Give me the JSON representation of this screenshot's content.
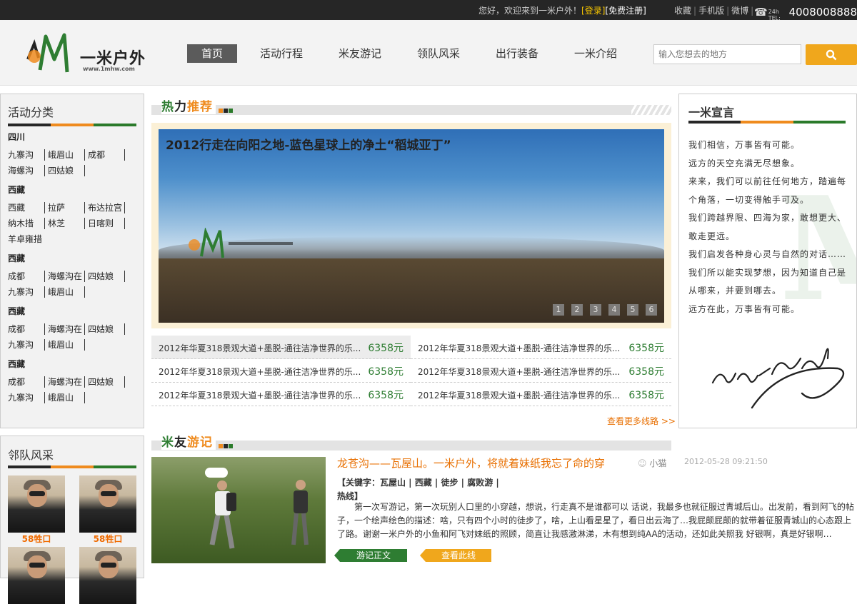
{
  "topbar": {
    "welcome": "您好，欢迎来到一米户外！",
    "login": "[登录]",
    "register": "[免费注册]",
    "links": [
      "收藏",
      "手机版",
      "微博"
    ],
    "tel_label": "24h TEL:",
    "tel_number": "4008008888"
  },
  "header": {
    "logo_text": "一米户外",
    "logo_url": "www.1mhw.com",
    "nav": [
      "首页",
      "活动行程",
      "米友游记",
      "领队风采",
      "出行装备",
      "一米介绍"
    ],
    "search_placeholder": "输入您想去的地方"
  },
  "categories": {
    "title": "活动分类",
    "groups": [
      {
        "region": "四川",
        "rows": [
          [
            "九寨沟",
            "峨眉山",
            "成都"
          ],
          [
            "海螺沟",
            "四姑娘"
          ]
        ]
      },
      {
        "region": "西藏",
        "rows": [
          [
            "西藏",
            "拉萨",
            "布达拉宫"
          ],
          [
            "纳木措",
            "林芝",
            "日喀则"
          ],
          [
            "羊卓雍措"
          ]
        ]
      },
      {
        "region": "西藏",
        "rows": [
          [
            "成都",
            "海螺沟在",
            "四姑娘"
          ],
          [
            "九寨沟",
            "峨眉山"
          ]
        ]
      },
      {
        "region": "西藏",
        "rows": [
          [
            "成都",
            "海螺沟在",
            "四姑娘"
          ],
          [
            "九寨沟",
            "峨眉山"
          ]
        ]
      },
      {
        "region": "西藏",
        "rows": [
          [
            "成都",
            "海螺沟在",
            "四姑娘"
          ],
          [
            "九寨沟",
            "峨眉山"
          ]
        ]
      }
    ]
  },
  "leaders": {
    "title": "邻队风采",
    "items": [
      {
        "name": "58牲口"
      },
      {
        "name": "58牲口"
      }
    ]
  },
  "hot": {
    "title_a": "热",
    "title_b": "力",
    "title_c": "推荐",
    "banner_caption": "2012行走在向阳之地-蓝色星球上的净土“稻城亚丁”",
    "pager": [
      "1",
      "2",
      "3",
      "4",
      "5",
      "6"
    ],
    "routes": [
      {
        "title": "2012年华夏318景观大道+墨脱-通往洁净世界的乐...",
        "price": "6358元"
      },
      {
        "title": "2012年华夏318景观大道+墨脱-通往洁净世界的乐...",
        "price": "6358元"
      },
      {
        "title": "2012年华夏318景观大道+墨脱-通往洁净世界的乐...",
        "price": "6358元"
      },
      {
        "title": "2012年华夏318景观大道+墨脱-通往洁净世界的乐...",
        "price": "6358元"
      },
      {
        "title": "2012年华夏318景观大道+墨脱-通往洁净世界的乐...",
        "price": "6358元"
      },
      {
        "title": "2012年华夏318景观大道+墨脱-通往洁净世界的乐...",
        "price": "6358元"
      }
    ],
    "more": "查看更多线路 >>"
  },
  "manifesto": {
    "title": "一米宣言",
    "lines": [
      "我们相信，万事皆有可能。",
      "远方的天空充满无尽想象。",
      "来来，我们可以前往任何地方，踏遍每个角落，一切变得触手可及。",
      "我们跨越界限、四海为家，敢想更大、敢走更远。",
      "我们启发各种身心灵与自然的对话……",
      "我们所以能实现梦想，因为知道自己是从哪来，并要到哪去。",
      "远方在此，万事皆有可能。"
    ]
  },
  "travel": {
    "title_a": "米",
    "title_b": "友",
    "title_c": "游记",
    "article_title": "龙苍沟——瓦屋山。一米户外，将就着妹纸我忘了命的穿",
    "author": "小猫",
    "date": "2012-05-28 09:21:50",
    "keywords": "【关键字：瓦屋山 | 西藏 | 徒步 | 腐败游 | 热线】",
    "body": "第一次写游记，第一次玩别人口里的小穿越，想说，行走真不是谁都可以 话说，我最多也就征服过青城后山。出发前，看到阿飞的帖子，一个绘声绘色的描述：啥，只有四个小时的徒步了，啥，上山看星星了，看日出云海了…我屁颠屁颠的就带着征服青城山的心态跟上了路。谢谢一米户外的小鱼和阿飞对妹纸的照顾，简直让我感激淋涕，木有想到纯AA的活动，还如此关照我 好银啊，真是好银啊…",
    "btn_read": "游记正文",
    "btn_route": "查看此线路"
  }
}
